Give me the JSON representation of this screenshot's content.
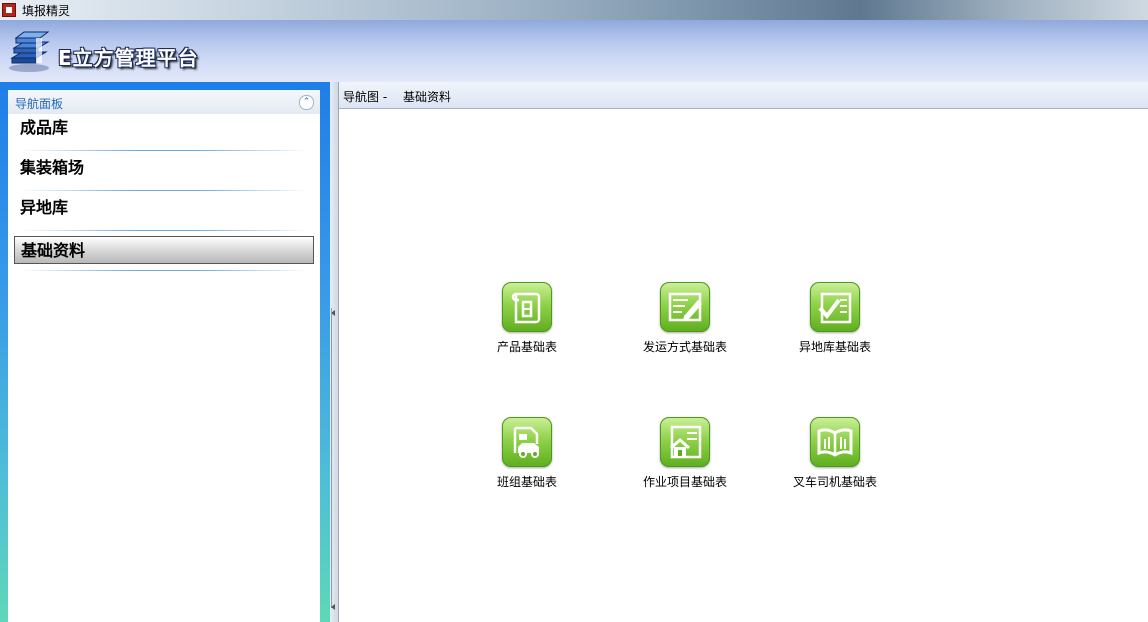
{
  "window": {
    "title": "填报精灵"
  },
  "header": {
    "brand": "E立方管理平台"
  },
  "sidebar": {
    "panel_title": "导航面板",
    "items": [
      {
        "label": "成品库"
      },
      {
        "label": "集装箱场"
      },
      {
        "label": "异地库"
      },
      {
        "label": "基础资料",
        "selected": true
      }
    ]
  },
  "breadcrumb": {
    "root": "导航图 -",
    "current": "基础资料"
  },
  "tiles": [
    {
      "label": "产品基础表",
      "icon": "document-list-icon"
    },
    {
      "label": "发运方式基础表",
      "icon": "edit-notes-icon"
    },
    {
      "label": "异地库基础表",
      "icon": "checklist-icon"
    },
    {
      "label": "班组基础表",
      "icon": "vehicle-document-icon"
    },
    {
      "label": "作业项目基础表",
      "icon": "house-list-icon"
    },
    {
      "label": "叉车司机基础表",
      "icon": "open-book-icon"
    }
  ],
  "colors": {
    "tile_green": "#6cc02a",
    "sidebar_accent": "#2568b8",
    "header_blue": "#b7c8ee"
  }
}
